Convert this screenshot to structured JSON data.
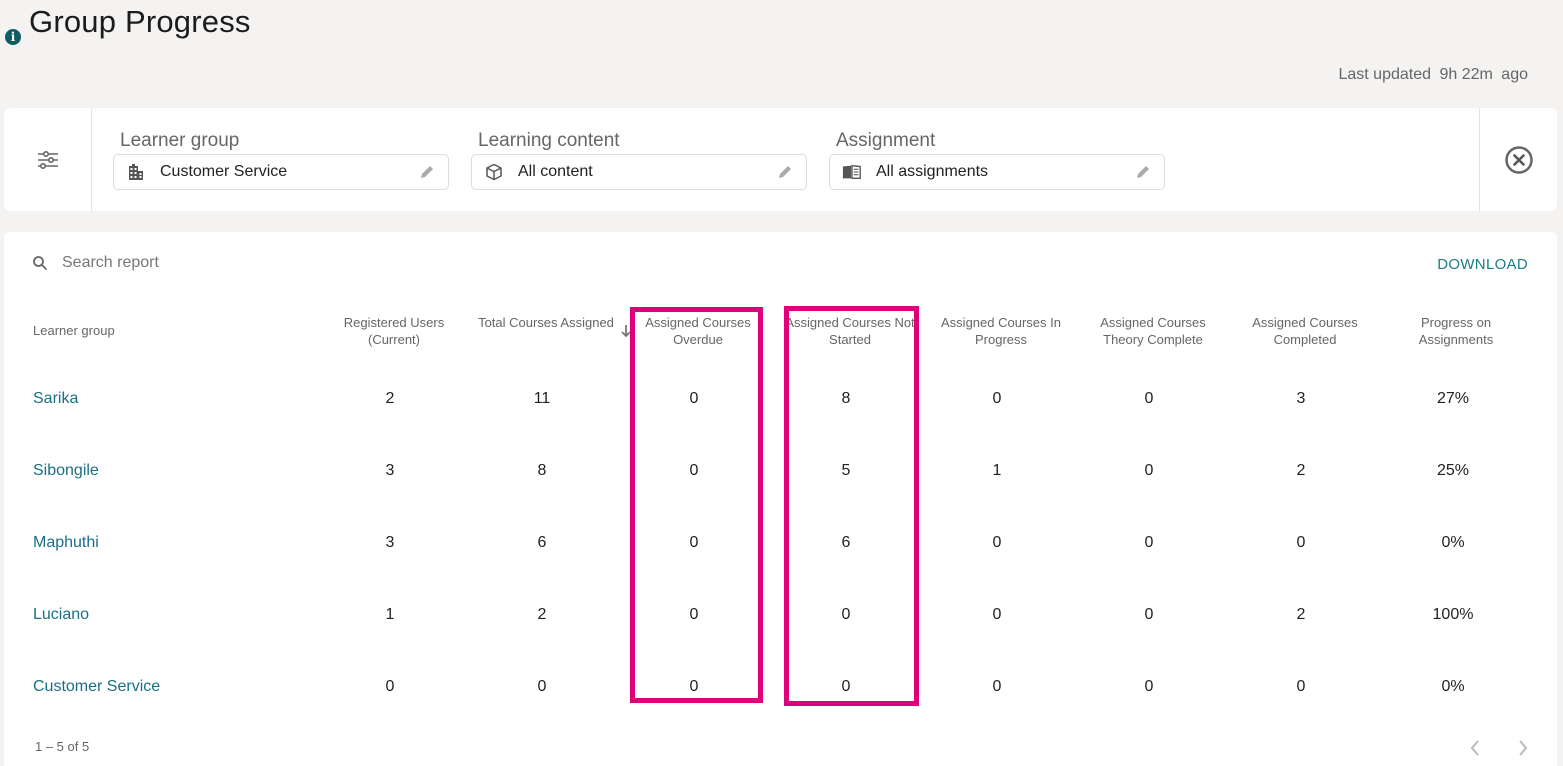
{
  "header": {
    "title": "Group Progress",
    "last_updated_label": "Last updated",
    "last_updated_value": "9h 22m",
    "last_updated_suffix": "ago"
  },
  "filters": {
    "learner_group": {
      "label": "Learner group",
      "value": "Customer Service",
      "icon": "building-icon"
    },
    "learning_content": {
      "label": "Learning content",
      "value": "All content",
      "icon": "cube-icon"
    },
    "assignment": {
      "label": "Assignment",
      "value": "All assignments",
      "icon": "book-icon"
    }
  },
  "report": {
    "search_placeholder": "Search report",
    "download_label": "DOWNLOAD",
    "columns": [
      "Learner group",
      "Registered Users (Current)",
      "Total Courses Assigned",
      "Assigned Courses Overdue",
      "Assigned Courses Not Started",
      "Assigned Courses In Progress",
      "Assigned Courses Theory Complete",
      "Assigned Courses Completed",
      "Progress on Assignments"
    ],
    "sorted_column": "Assigned Courses Overdue",
    "sort_direction": "descending",
    "highlighted_columns": [
      "Assigned Courses Overdue",
      "Assigned Courses Not Started"
    ],
    "highlight_color": "#e0007a",
    "rows": [
      [
        "Sarika",
        "2",
        "11",
        "0",
        "8",
        "0",
        "0",
        "3",
        "27%"
      ],
      [
        "Sibongile",
        "3",
        "8",
        "0",
        "5",
        "1",
        "0",
        "2",
        "25%"
      ],
      [
        "Maphuthi",
        "3",
        "6",
        "0",
        "6",
        "0",
        "0",
        "0",
        "0%"
      ],
      [
        "Luciano",
        "1",
        "2",
        "0",
        "0",
        "0",
        "0",
        "2",
        "100%"
      ],
      [
        "Customer Service",
        "0",
        "0",
        "0",
        "0",
        "0",
        "0",
        "0",
        "0%"
      ]
    ],
    "pagination": "1 – 5 of 5"
  },
  "colors": {
    "accent": "#1a7d8a",
    "link": "#1a6f86",
    "info_icon": "#0f5c66",
    "background": "#f4f3f2"
  }
}
